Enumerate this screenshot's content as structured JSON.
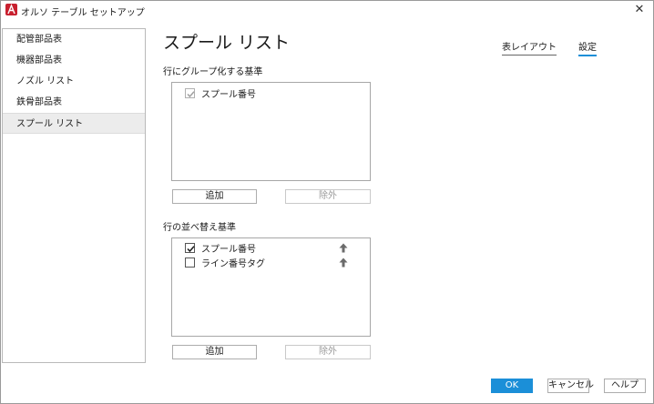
{
  "window": {
    "title": "オルソ テーブル セットアップ",
    "close_glyph": "✕"
  },
  "sidebar": {
    "items": [
      {
        "label": "配管部品表"
      },
      {
        "label": "機器部品表"
      },
      {
        "label": "ノズル リスト"
      },
      {
        "label": "鉄骨部品表"
      },
      {
        "label": "スプール リスト"
      }
    ],
    "selected_index": 4
  },
  "main": {
    "title": "スプール リスト",
    "tabs": [
      {
        "label": "表レイアウト",
        "active": false
      },
      {
        "label": "設定",
        "active": true
      }
    ],
    "group_section": {
      "label": "行にグループ化する基準",
      "rows": [
        {
          "label": "スプール番号",
          "checked": true,
          "disabled": true
        }
      ],
      "add_label": "追加",
      "remove_label": "除外"
    },
    "sort_section": {
      "label": "行の並べ替え基準",
      "rows": [
        {
          "label": "スプール番号",
          "checked": true,
          "disabled": false
        },
        {
          "label": "ライン番号タグ",
          "checked": false,
          "disabled": false
        }
      ],
      "add_label": "追加",
      "remove_label": "除外"
    }
  },
  "footer": {
    "ok_label": "OK",
    "cancel_label": "キャンセル",
    "help_label": "ヘルプ"
  },
  "colors": {
    "accent": "#1b8fd8",
    "app_icon": "#c8202f"
  },
  "icons": {
    "app": "autocad-plant-icon",
    "close": "close-icon",
    "sort_up": "arrow-up-icon",
    "check": "checkmark-icon"
  }
}
